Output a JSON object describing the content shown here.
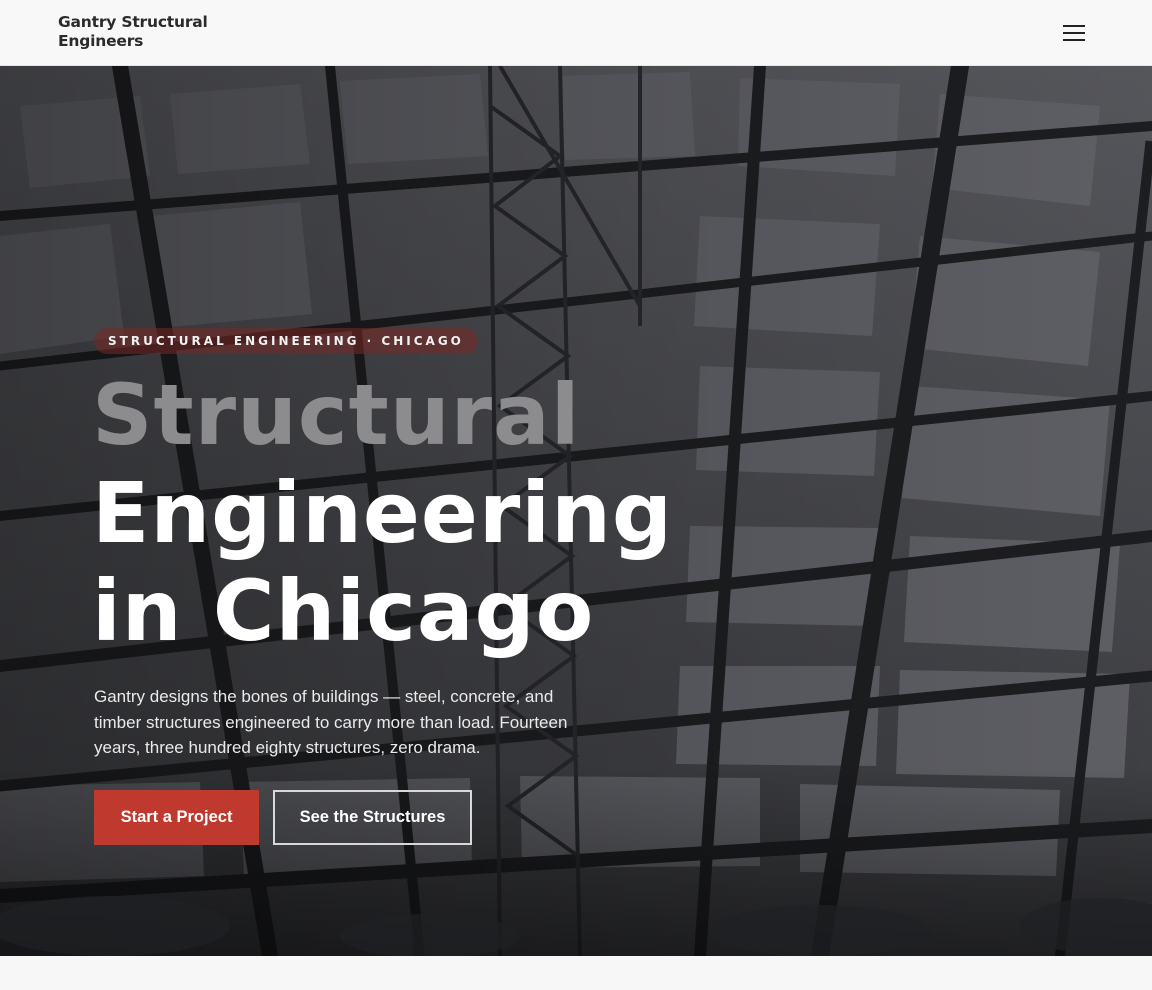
{
  "header": {
    "logo_line1": "Gantry Structural",
    "logo_line2": "Engineers",
    "menu_icon": "hamburger-menu-icon"
  },
  "hero": {
    "eyebrow": "STRUCTURAL ENGINEERING · CHICAGO",
    "headline_line1": "Structural",
    "headline_line2": "Engineering",
    "headline_line3": "in Chicago",
    "lede": "Gantry designs the bones of buildings — steel, concrete, and timber structures engineered to carry more than load. Fourteen years, three hundred eighty structures, zero drama.",
    "primary_cta": "Start a Project",
    "secondary_cta": "See the Structures"
  },
  "colors": {
    "accent": "#c0392f",
    "header_bg": "#f8f8f8",
    "hero_overlay": "#4a4b50",
    "headline_muted": "#8c8c8f",
    "headline_white": "#ffffff"
  }
}
